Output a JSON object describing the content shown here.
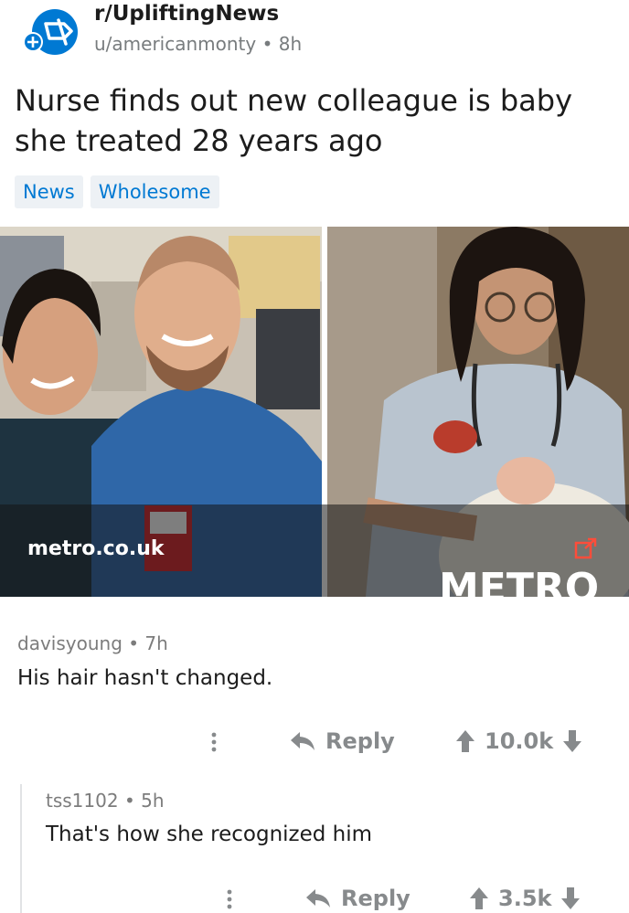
{
  "post": {
    "subreddit": "r/UpliftingNews",
    "author": "u/americanmonty",
    "age": "8h",
    "title": "Nurse finds out new colleague is baby she treated 28 years ago",
    "flairs": [
      "News",
      "Wholesome"
    ],
    "link_domain": "metro.co.uk",
    "watermark": "METRO"
  },
  "comments": [
    {
      "author": "davisyoung",
      "age": "7h",
      "body": "His hair hasn't changed.",
      "reply_label": "Reply",
      "score": "10.0k"
    },
    {
      "author": "tss1102",
      "age": "5h",
      "body": "That's how she recognized him",
      "reply_label": "Reply",
      "score": "3.5k"
    }
  ],
  "colors": {
    "accent": "#0079d3",
    "subreddit_icon": "#0079d3",
    "muted": "#878a8c",
    "flair_bg": "#edf1f5"
  },
  "icons": [
    "subreddit-icon",
    "external-link-icon",
    "more-icon",
    "reply-icon",
    "upvote-icon",
    "downvote-icon"
  ]
}
